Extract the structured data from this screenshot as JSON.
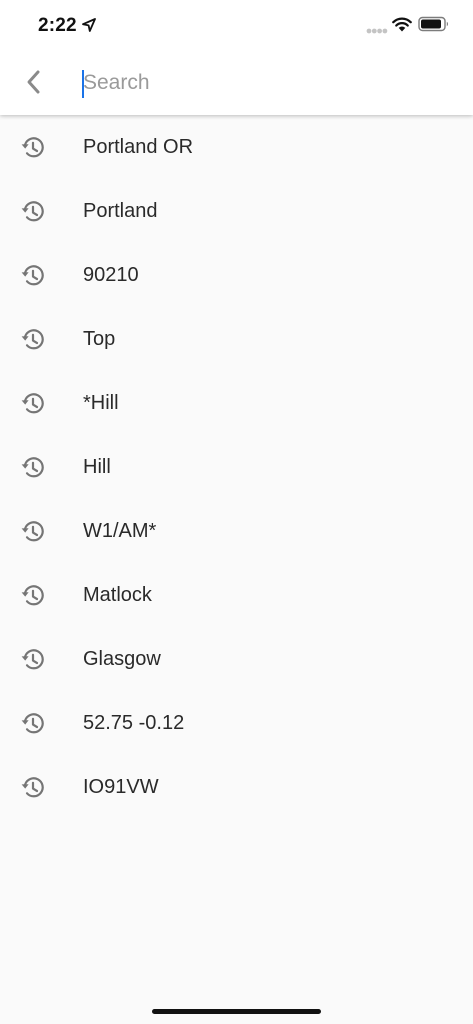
{
  "status_bar": {
    "time": "2:22"
  },
  "search": {
    "placeholder": "Search",
    "value": ""
  },
  "history": [
    {
      "label": "Portland OR"
    },
    {
      "label": "Portland"
    },
    {
      "label": "90210"
    },
    {
      "label": "Top"
    },
    {
      "label": "*Hill"
    },
    {
      "label": "Hill"
    },
    {
      "label": "W1/AM*"
    },
    {
      "label": "Matlock"
    },
    {
      "label": "Glasgow"
    },
    {
      "label": "52.75 -0.12"
    },
    {
      "label": "IO91VW"
    }
  ],
  "icons": {
    "back": "chevron-left-icon",
    "history": "history-icon",
    "location": "location-arrow-icon",
    "signal": "cellular-signal-icon",
    "wifi": "wifi-icon",
    "battery": "battery-icon"
  },
  "colors": {
    "accent": "#1a73e8",
    "background": "#fafafa",
    "header": "#ffffff",
    "icon_gray": "#757575",
    "text": "#2a2a2a"
  }
}
